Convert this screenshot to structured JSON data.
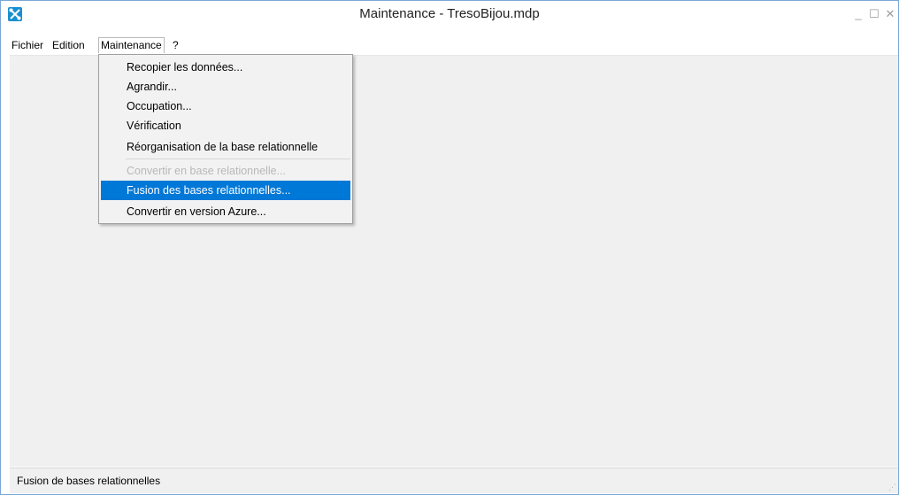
{
  "window": {
    "title": "Maintenance - TresoBijou.mdp",
    "minimize": "_",
    "maximize": "☐",
    "close": "✕",
    "app_icon": "tools-icon"
  },
  "menubar": {
    "items": [
      {
        "label": "Fichier"
      },
      {
        "label": "Edition"
      },
      {
        "label": "Maintenance"
      },
      {
        "label": "?"
      }
    ]
  },
  "dropdown": {
    "items": [
      {
        "label": "Recopier les données...",
        "enabled": true
      },
      {
        "label": "Agrandir...",
        "enabled": true
      },
      {
        "label": "Occupation...",
        "enabled": true
      },
      {
        "label": "Vérification",
        "enabled": true
      },
      {
        "label": "Réorganisation de la base relationnelle",
        "enabled": true
      },
      {
        "label": "Convertir en base relationnelle...",
        "enabled": false
      },
      {
        "label": "Fusion des bases relationnelles...",
        "enabled": true,
        "highlighted": true
      },
      {
        "label": "Convertir en version Azure...",
        "enabled": true
      }
    ]
  },
  "statusbar": {
    "text": "Fusion de bases relationnelles"
  },
  "colors": {
    "highlight": "#0078d7",
    "client_background": "#f0f0f0"
  }
}
